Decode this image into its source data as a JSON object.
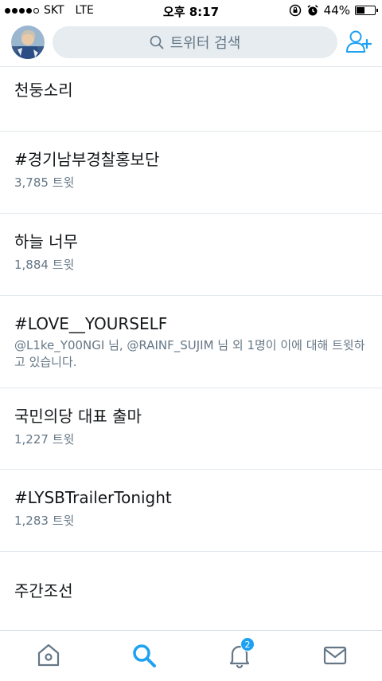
{
  "status_bar": {
    "carrier": "SKT",
    "network": "LTE",
    "time": "오후 8:17",
    "battery_percent": "44%",
    "battery_level": 0.44
  },
  "header": {
    "search_placeholder": "트위터 검색",
    "avatar_icon": "avatar",
    "add_user_icon": "add-user-icon"
  },
  "trends": [
    {
      "title": "천둥소리",
      "subtitle": ""
    },
    {
      "title": "#경기남부경찰홍보단",
      "subtitle": "3,785 트윗"
    },
    {
      "title": "하늘 너무",
      "subtitle": "1,884 트윗"
    },
    {
      "title": "#LOVE__YOURSELF",
      "subtitle": "@L1ke_Y00NGI 님, @RAINF_SUJIM 님 외 1명이 이에 대해 트윗하고 있습니다."
    },
    {
      "title": "국민의당 대표 출마",
      "subtitle": "1,227 트윗"
    },
    {
      "title": "#LYSBTrailerTonight",
      "subtitle": "1,283 트윗"
    },
    {
      "title": "주간조선",
      "subtitle": ""
    }
  ],
  "tab_bar": {
    "notifications_badge": "2",
    "active_color": "#1da1f2",
    "inactive_color": "#657786"
  }
}
